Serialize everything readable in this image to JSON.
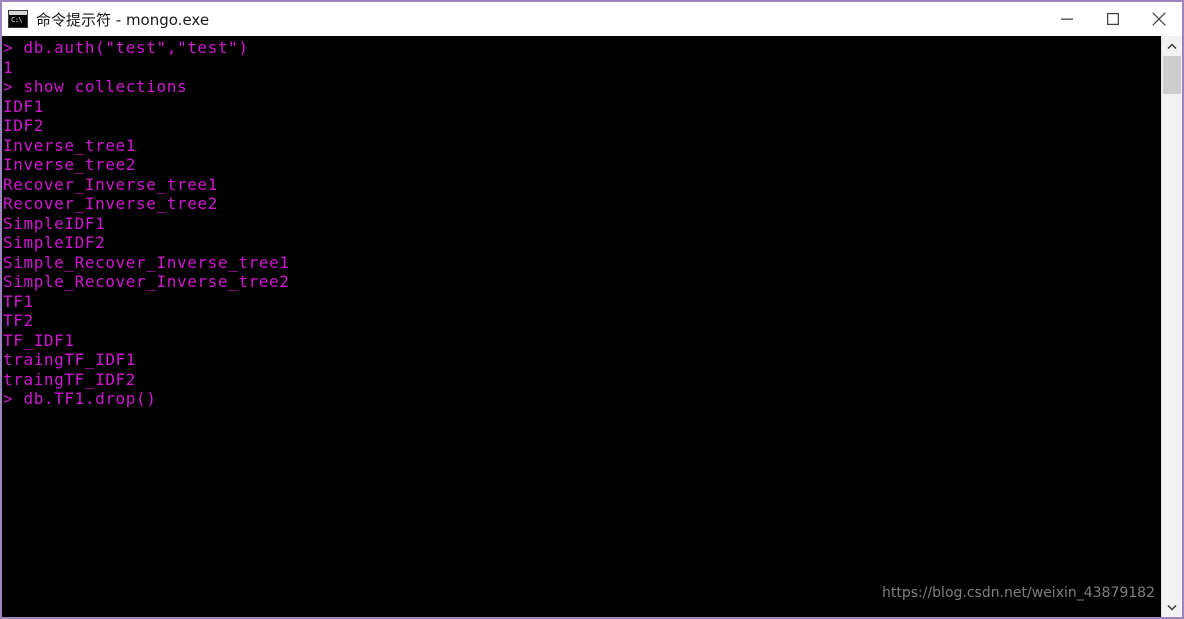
{
  "window": {
    "title": "命令提示符 - mongo.exe",
    "app_icon": "console-icon",
    "icon_glyph": "C:\\",
    "border_color": "#9a85bf",
    "titlebar_bg": "#ffffff"
  },
  "controls": {
    "minimize_label": "Minimize",
    "maximize_label": "Maximize",
    "close_label": "Close"
  },
  "console": {
    "background": "#000000",
    "text_color": "#d016d0",
    "lines": [
      "> db.auth(\"test\",\"test\")",
      "1",
      "> show collections",
      "IDF1",
      "IDF2",
      "Inverse_tree1",
      "Inverse_tree2",
      "Recover_Inverse_tree1",
      "Recover_Inverse_tree2",
      "SimpleIDF1",
      "SimpleIDF2",
      "Simple_Recover_Inverse_tree1",
      "Simple_Recover_Inverse_tree2",
      "TF1",
      "TF2",
      "TF_IDF1",
      "traingTF_IDF1",
      "traingTF_IDF2",
      "> db.TF1.drop()"
    ]
  },
  "watermark": {
    "text": "https://blog.csdn.net/weixin_43879182"
  },
  "scrollbar": {
    "up_arrow": "chevron-up-icon",
    "down_arrow": "chevron-down-icon",
    "thumb_label": "scroll-thumb"
  }
}
